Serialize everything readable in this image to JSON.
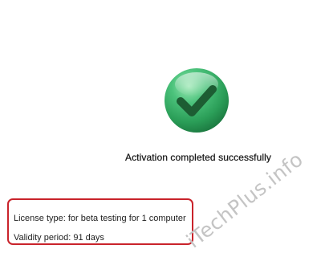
{
  "activation": {
    "icon": "green-checkmark-icon",
    "message": "Activation completed successfully"
  },
  "license": {
    "type_text": "License type: for beta testing for 1 computer",
    "validity_text": "Validity period: 91 days",
    "highlight_color": "#c9232b"
  },
  "watermark": {
    "text": "iTechPlus.info"
  },
  "colors": {
    "success_green": "#2fae5e",
    "background": "#ffffff"
  }
}
